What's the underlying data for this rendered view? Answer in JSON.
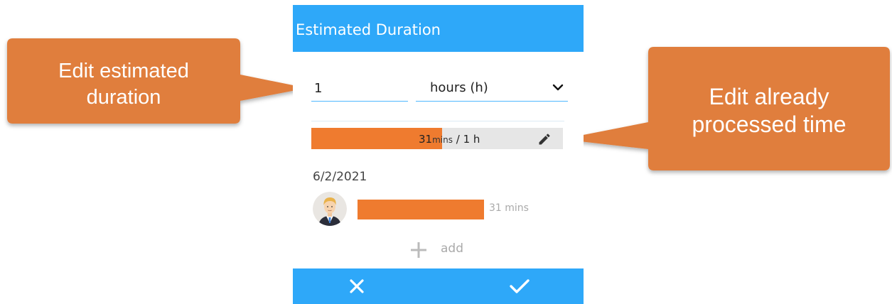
{
  "dialog": {
    "title": "Estimated Duration",
    "duration_value": "1",
    "unit_select": {
      "selected": "hours (h)"
    },
    "progress": {
      "processed_value": "31",
      "processed_unit": "mins",
      "separator": " / ",
      "estimated": "1 h",
      "fraction": 0.52
    },
    "log": {
      "date": "6/2/2021",
      "entries": [
        {
          "duration": "31 mins",
          "fraction": 0.52
        }
      ]
    },
    "add_label": "add",
    "footer": {
      "cancel_icon": "close-icon",
      "confirm_icon": "check-icon"
    }
  },
  "callouts": {
    "left": {
      "line1": "Edit estimated",
      "line2": "duration"
    },
    "right": {
      "line1": "Edit already",
      "line2": "processed time"
    }
  },
  "colors": {
    "primary": "#2ea8f9",
    "accent": "#ef7b2f",
    "callout": "#e07e3c",
    "track": "#e6e6e6",
    "input_underline": "#4fb8ff"
  }
}
